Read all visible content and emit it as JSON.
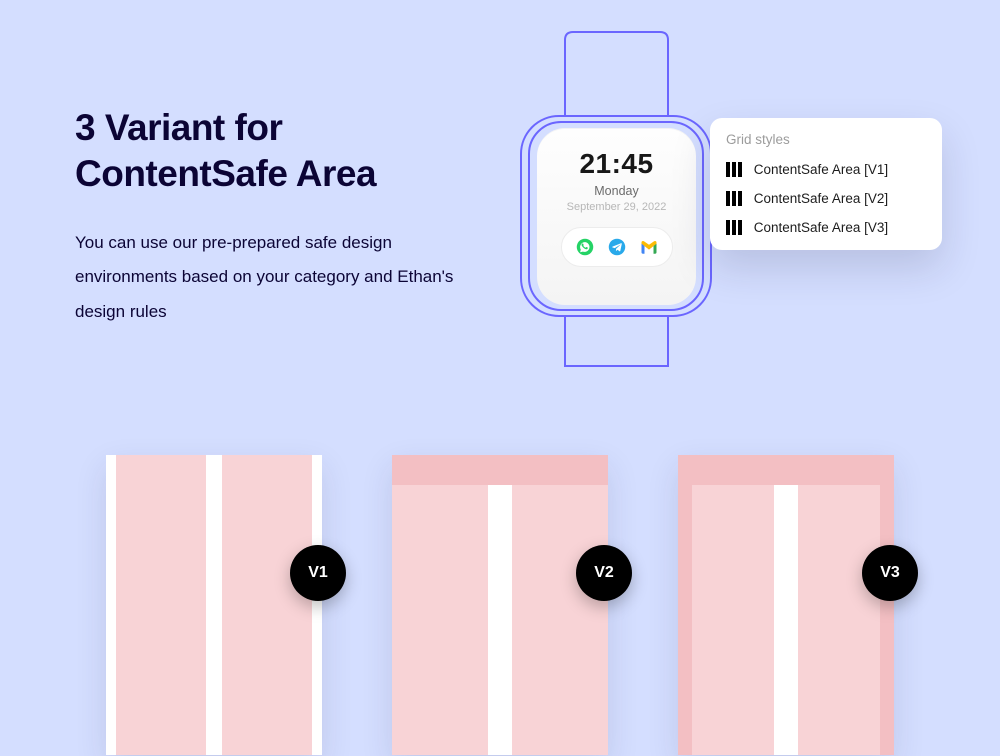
{
  "heading": "3 Variant for ContentSafe Area",
  "description": "You can use our pre-prepared safe design environments based on your category and Ethan's design rules",
  "watch": {
    "time": "21:45",
    "day": "Monday",
    "date": "September 29, 2022"
  },
  "popover": {
    "title": "Grid styles",
    "items": [
      "ContentSafe Area [V1]",
      "ContentSafe Area [V2]",
      "ContentSafe Area [V3]"
    ]
  },
  "variants": [
    {
      "label": "V1"
    },
    {
      "label": "V2"
    },
    {
      "label": "V3"
    }
  ],
  "icons": {
    "whatsapp": "whatsapp-icon",
    "telegram": "telegram-icon",
    "gmail": "gmail-icon"
  },
  "colors": {
    "page_bg": "#d4deff",
    "watch_stroke": "#6b66ff",
    "card_pink": "#f8d3d6",
    "card_pink_dark": "#f3bfc3",
    "badge_bg": "#000000"
  }
}
